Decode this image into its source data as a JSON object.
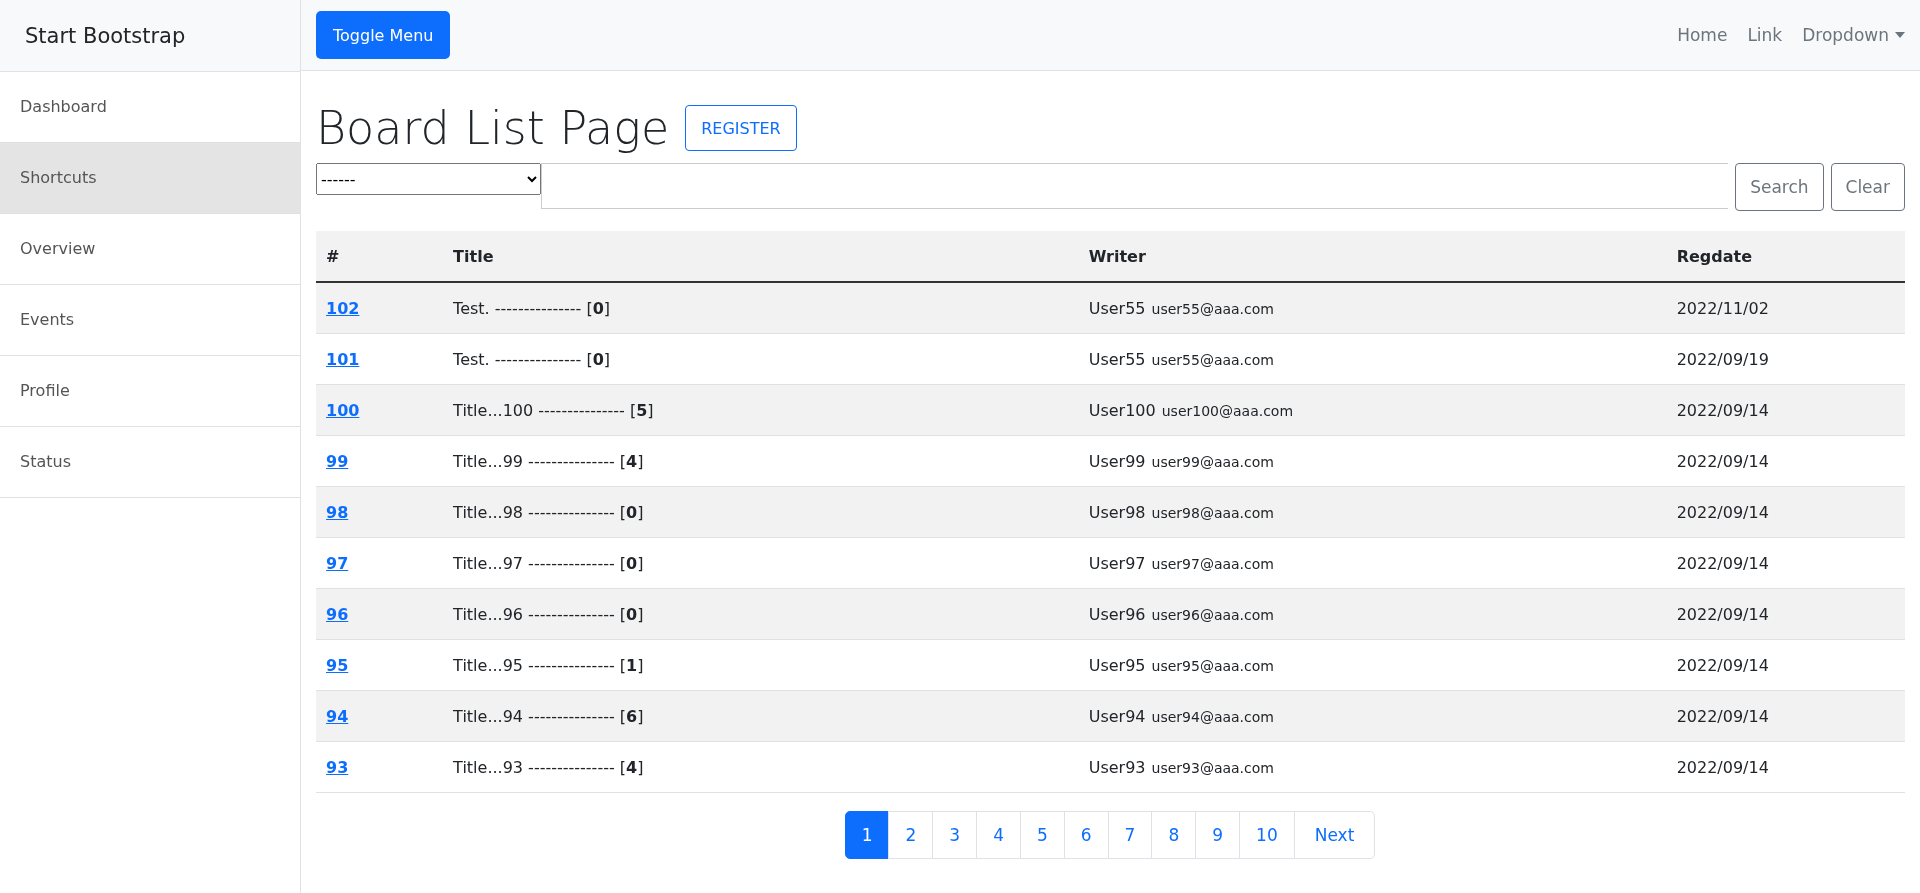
{
  "sidebar": {
    "brand": "Start Bootstrap",
    "items": [
      {
        "label": "Dashboard",
        "selected": false
      },
      {
        "label": "Shortcuts",
        "selected": true
      },
      {
        "label": "Overview",
        "selected": false
      },
      {
        "label": "Events",
        "selected": false
      },
      {
        "label": "Profile",
        "selected": false
      },
      {
        "label": "Status",
        "selected": false
      }
    ]
  },
  "navbar": {
    "toggle_button": "Toggle Menu",
    "links": [
      {
        "label": "Home",
        "kind": "link"
      },
      {
        "label": "Link",
        "kind": "link"
      },
      {
        "label": "Dropdown",
        "kind": "dropdown"
      }
    ]
  },
  "page_title": "Board List Page",
  "register_button": "REGISTER",
  "search": {
    "type_select": "------",
    "search_button": "Search",
    "clear_button": "Clear"
  },
  "table": {
    "columns": [
      "#",
      "Title",
      "Writer",
      "Regdate"
    ],
    "rows": [
      {
        "number": "102",
        "title": "Test. --------------- [**0**]",
        "writer": "User55",
        "email": "user55@aaa.com",
        "regdate": "2022/11/02"
      },
      {
        "number": "101",
        "title": "Test. --------------- [**0**]",
        "writer": "User55",
        "email": "user55@aaa.com",
        "regdate": "2022/09/19"
      },
      {
        "number": "100",
        "title": "Title...100 --------------- [**5**]",
        "writer": "User100",
        "email": "user100@aaa.com",
        "regdate": "2022/09/14"
      },
      {
        "number": "99",
        "title": "Title...99 --------------- [**4**]",
        "writer": "User99",
        "email": "user99@aaa.com",
        "regdate": "2022/09/14"
      },
      {
        "number": "98",
        "title": "Title...98 --------------- [**0**]",
        "writer": "User98",
        "email": "user98@aaa.com",
        "regdate": "2022/09/14"
      },
      {
        "number": "97",
        "title": "Title...97 --------------- [**0**]",
        "writer": "User97",
        "email": "user97@aaa.com",
        "regdate": "2022/09/14"
      },
      {
        "number": "96",
        "title": "Title...96 --------------- [**0**]",
        "writer": "User96",
        "email": "user96@aaa.com",
        "regdate": "2022/09/14"
      },
      {
        "number": "95",
        "title": "Title...95 --------------- [**1**]",
        "writer": "User95",
        "email": "user95@aaa.com",
        "regdate": "2022/09/14"
      },
      {
        "number": "94",
        "title": "Title...94 --------------- [**6**]",
        "writer": "User94",
        "email": "user94@aaa.com",
        "regdate": "2022/09/14"
      },
      {
        "number": "93",
        "title": "Title...93 --------------- [**4**]",
        "writer": "User93",
        "email": "user93@aaa.com",
        "regdate": "2022/09/14"
      }
    ]
  },
  "pagination": {
    "pages": [
      {
        "label": "1",
        "selected": true
      },
      {
        "label": "2",
        "selected": false
      },
      {
        "label": "3",
        "selected": false
      },
      {
        "label": "4",
        "selected": false
      },
      {
        "label": "5",
        "selected": false
      },
      {
        "label": "6",
        "selected": false
      },
      {
        "label": "7",
        "selected": false
      },
      {
        "label": "8",
        "selected": false
      },
      {
        "label": "9",
        "selected": false
      },
      {
        "label": "10",
        "selected": false
      }
    ],
    "next": "Next"
  }
}
